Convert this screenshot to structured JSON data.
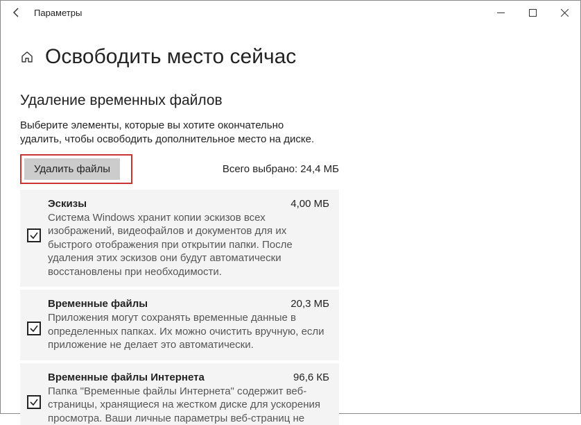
{
  "window": {
    "title": "Параметры"
  },
  "page": {
    "title": "Освободить место сейчас",
    "section": "Удаление временных файлов",
    "description": "Выберите элементы, которые вы хотите окончательно удалить, чтобы освободить дополнительное место на диске.",
    "delete_button": "Удалить файлы",
    "selected_label": "Всего выбрано: 24,4 МБ"
  },
  "items": [
    {
      "title": "Эскизы",
      "size": "4,00 МБ",
      "desc": "Система Windows хранит копии эскизов всех изображений, видеофайлов и документов для их быстрого отображения при открытии папки. После удаления этих эскизов они будут автоматически восстановлены при необходимости."
    },
    {
      "title": "Временные файлы",
      "size": "20,3 МБ",
      "desc": "Приложения могут сохранять временные данные в определенных папках. Их можно очистить вручную, если приложение не делает это автоматически."
    },
    {
      "title": "Временные файлы Интернета",
      "size": "96,6 КБ",
      "desc": "Папка \"Временные файлы Интернета\" содержит веб-страницы, хранящиеся на жестком диске для ускорения просмотра. Ваши личные параметры веб-страниц не"
    }
  ]
}
